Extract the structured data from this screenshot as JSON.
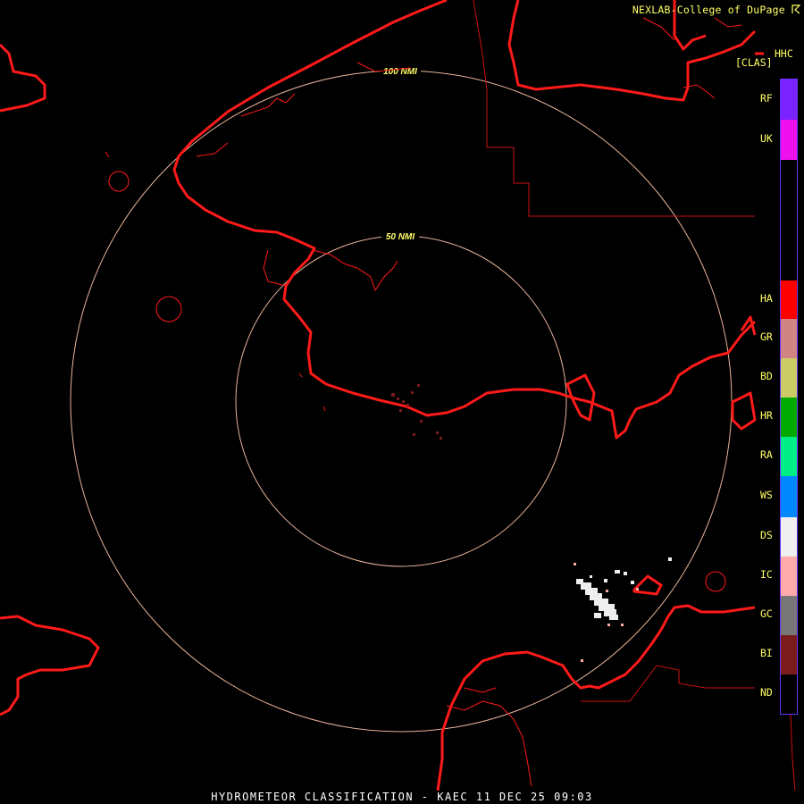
{
  "header": {
    "credit": "NEXLAB-College of DuPage",
    "product_code": "HHC",
    "product_type": "[CLAS]"
  },
  "rings": {
    "inner_label": "50 NMI",
    "outer_label": "100 NMI",
    "color": "#e8b49a"
  },
  "legend": {
    "items": [
      {
        "code": "RF",
        "color": "#7a22ff"
      },
      {
        "code": "UK",
        "color": "#ee11ee"
      },
      {
        "code": "HA",
        "color": "#ff0000"
      },
      {
        "code": "GR",
        "color": "#d08484"
      },
      {
        "code": "BD",
        "color": "#cccc66"
      },
      {
        "code": "HR",
        "color": "#00aa00"
      },
      {
        "code": "RA",
        "color": "#00ee88"
      },
      {
        "code": "WS",
        "color": "#0088ff"
      },
      {
        "code": "DS",
        "color": "#eeeeee"
      },
      {
        "code": "IC",
        "color": "#ffaaaa"
      },
      {
        "code": "GC",
        "color": "#777777"
      },
      {
        "code": "BI",
        "color": "#7a1c1c"
      },
      {
        "code": "ND",
        "color": "#000000"
      }
    ]
  },
  "map_colors": {
    "coast": "#ff1a1a",
    "border": "#cc1111",
    "label": "#ffff66"
  },
  "footer": {
    "caption": "HYDROMETEOR CLASSIFICATION - KAEC 11 DEC 25 09:03"
  }
}
